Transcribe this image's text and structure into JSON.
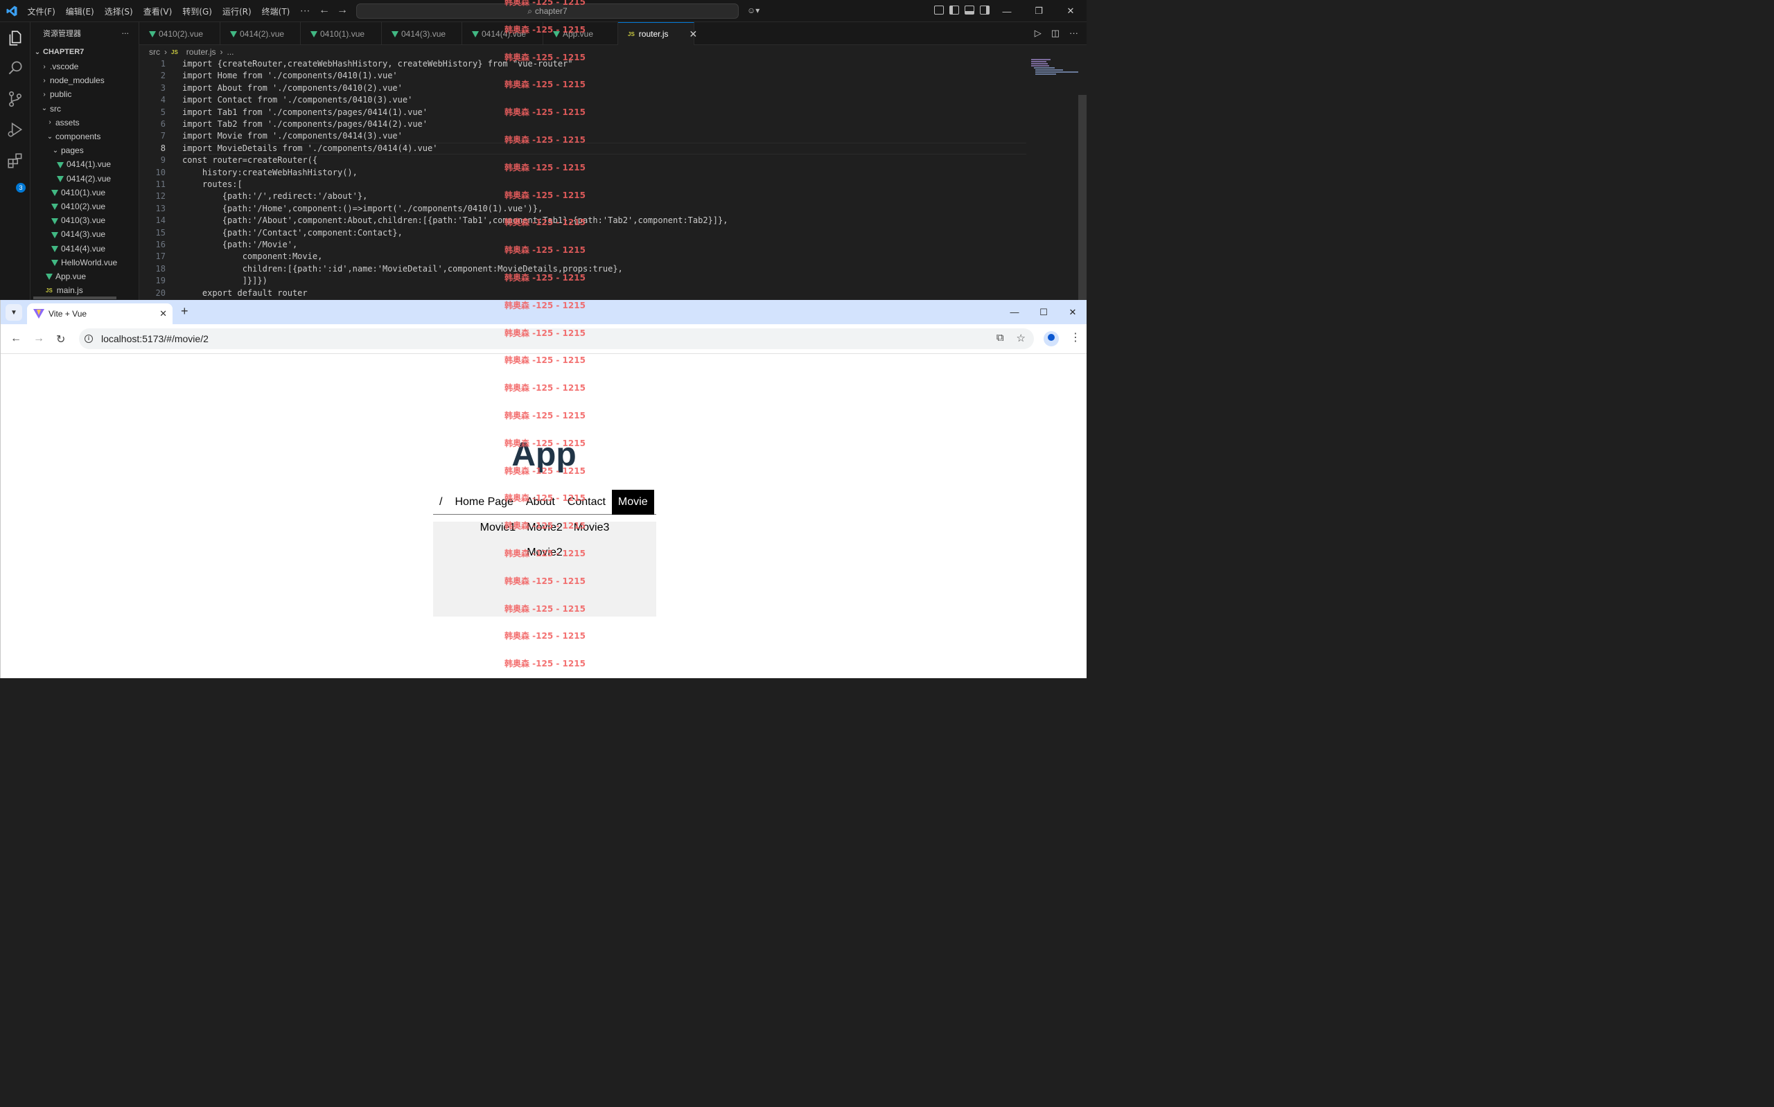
{
  "vscode": {
    "menu": [
      "文件(F)",
      "编辑(E)",
      "选择(S)",
      "查看(V)",
      "转到(G)",
      "运行(R)",
      "终端(T)",
      "···"
    ],
    "search_text": "chapter7",
    "explorer_title": "资源管理器",
    "explorer_more": "···",
    "root_folder": "CHAPTER7",
    "extensions_badge": "3",
    "tree": [
      {
        "label": ".vscode",
        "kind": "folder",
        "open": false,
        "indent": 0
      },
      {
        "label": "node_modules",
        "kind": "folder",
        "open": false,
        "indent": 0
      },
      {
        "label": "public",
        "kind": "folder",
        "open": false,
        "indent": 0
      },
      {
        "label": "src",
        "kind": "folder",
        "open": true,
        "indent": 0
      },
      {
        "label": "assets",
        "kind": "folder",
        "open": false,
        "indent": 1
      },
      {
        "label": "components",
        "kind": "folder",
        "open": true,
        "indent": 1
      },
      {
        "label": "pages",
        "kind": "folder",
        "open": true,
        "indent": 2
      },
      {
        "label": "0414(1).vue",
        "kind": "vue",
        "indent": 3
      },
      {
        "label": "0414(2).vue",
        "kind": "vue",
        "indent": 3
      },
      {
        "label": "0410(1).vue",
        "kind": "vue",
        "indent": 2
      },
      {
        "label": "0410(2).vue",
        "kind": "vue",
        "indent": 2
      },
      {
        "label": "0410(3).vue",
        "kind": "vue",
        "indent": 2
      },
      {
        "label": "0414(3).vue",
        "kind": "vue",
        "indent": 2
      },
      {
        "label": "0414(4).vue",
        "kind": "vue",
        "indent": 2
      },
      {
        "label": "HelloWorld.vue",
        "kind": "vue",
        "indent": 2
      },
      {
        "label": "App.vue",
        "kind": "vue",
        "indent": 1
      },
      {
        "label": "main.js",
        "kind": "js",
        "indent": 1
      }
    ],
    "tabs": [
      {
        "label": "0410(2).vue",
        "kind": "vue",
        "active": false
      },
      {
        "label": "0414(2).vue",
        "kind": "vue",
        "active": false
      },
      {
        "label": "0410(1).vue",
        "kind": "vue",
        "active": false
      },
      {
        "label": "0414(3).vue",
        "kind": "vue",
        "active": false
      },
      {
        "label": "0414(4).vue",
        "kind": "vue",
        "active": false
      },
      {
        "label": "App.vue",
        "kind": "vue",
        "active": false
      },
      {
        "label": "router.js",
        "kind": "js",
        "active": true
      }
    ],
    "tab_close": "✕",
    "breadcrumb": [
      "src",
      "router.js",
      "..."
    ],
    "current_line": 8,
    "code": [
      "import {createRouter,createWebHashHistory, createWebHistory} from \"vue-router\"",
      "import Home from './components/0410(1).vue'",
      "import About from './components/0410(2).vue'",
      "import Contact from './components/0410(3).vue'",
      "import Tab1 from './components/pages/0414(1).vue'",
      "import Tab2 from './components/pages/0414(2).vue'",
      "import Movie from './components/0414(3).vue'",
      "import MovieDetails from './components/0414(4).vue'",
      "const router=createRouter({",
      "    history:createWebHashHistory(),",
      "    routes:[",
      "        {path:'/',redirect:'/about'},",
      "        {path:'/Home',component:()=>import('./components/0410(1).vue')},",
      "        {path:'/About',component:About,children:[{path:'Tab1',component:Tab1},{path:'Tab2',component:Tab2}]},",
      "        {path:'/Contact',component:Contact},",
      "        {path:'/Movie',",
      "            component:Movie,",
      "            children:[{path:':id',name:'MovieDetail',component:MovieDetails,props:true},",
      "            ]}]})",
      "    export default router"
    ]
  },
  "browser": {
    "tab_title": "Vite + Vue",
    "url": "localhost:5173/#/movie/2",
    "page": {
      "title": "App",
      "nav": [
        {
          "label": "/",
          "active": false
        },
        {
          "label": "Home Page",
          "active": false
        },
        {
          "label": "About",
          "active": false
        },
        {
          "label": "Contact",
          "active": false
        },
        {
          "label": "Movie",
          "active": true
        }
      ],
      "movies": [
        "Movie1",
        "Movie2",
        "Movie3"
      ],
      "detail": "Movie2"
    }
  },
  "watermark": {
    "text": "韩奥森 -125 - 1215",
    "color": "#f26060"
  }
}
